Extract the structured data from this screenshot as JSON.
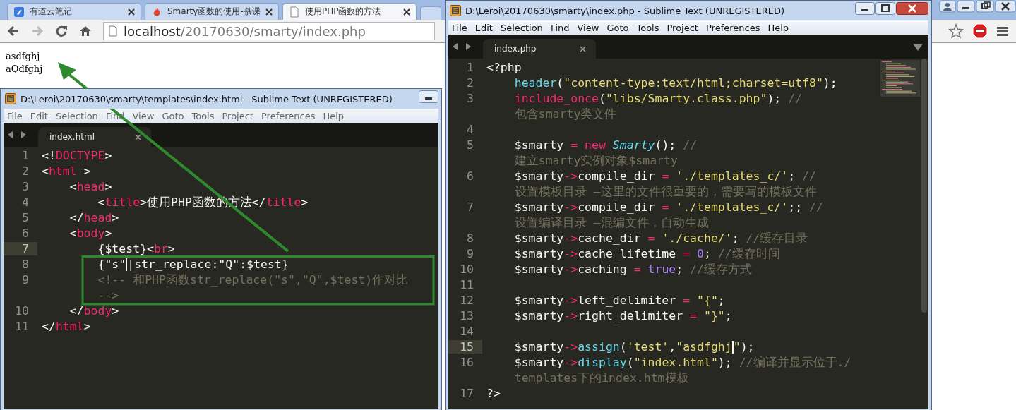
{
  "browser": {
    "tabs": [
      {
        "title": "有道云笔记",
        "selected": false
      },
      {
        "title": "Smarty函数的使用-慕课",
        "selected": false
      },
      {
        "title": "使用PHP函数的方法",
        "selected": true
      }
    ],
    "buttons": [
      {
        "kind": "back",
        "disabled": false
      },
      {
        "kind": "forward",
        "disabled": true
      },
      {
        "kind": "reload",
        "disabled": false
      },
      {
        "kind": "home",
        "disabled": false
      }
    ],
    "address": {
      "host": "localhost",
      "path": "/20170630/smarty/index.php"
    },
    "page_lines": [
      "asdfghj",
      "aQdfghj"
    ]
  },
  "editors": [
    {
      "title": "D:\\Leroi\\20170630\\smarty\\templates\\index.html - Sublime Text (UNREGISTERED)",
      "menu": [
        "File",
        "Edit",
        "Selection",
        "Find",
        "View",
        "Goto",
        "Tools",
        "Project",
        "Preferences",
        "Help"
      ],
      "tab": "index.html",
      "lines": [
        {
          "number": "1",
          "current": false,
          "rows": [
            [
              {
                "kind": "plain",
                "text": "<!"
              },
              {
                "kind": "tag",
                "text": "DOCTYPE"
              },
              {
                "kind": "plain",
                "text": ">"
              }
            ]
          ]
        },
        {
          "number": "2",
          "current": false,
          "rows": [
            [
              {
                "kind": "plain",
                "text": "<"
              },
              {
                "kind": "tag",
                "text": "html"
              },
              {
                "kind": "plain",
                "text": " >"
              }
            ]
          ]
        },
        {
          "number": "3",
          "current": false,
          "rows": [
            [
              {
                "kind": "plain",
                "text": "    <"
              },
              {
                "kind": "tag",
                "text": "head"
              },
              {
                "kind": "plain",
                "text": ">"
              }
            ]
          ]
        },
        {
          "number": "4",
          "current": false,
          "rows": [
            [
              {
                "kind": "plain",
                "text": "        <"
              },
              {
                "kind": "tag",
                "text": "title"
              },
              {
                "kind": "plain",
                "text": ">使用PHP函数的方法</"
              },
              {
                "kind": "tag",
                "text": "title"
              },
              {
                "kind": "plain",
                "text": ">"
              }
            ]
          ]
        },
        {
          "number": "5",
          "current": false,
          "rows": [
            [
              {
                "kind": "plain",
                "text": "    </"
              },
              {
                "kind": "tag",
                "text": "head"
              },
              {
                "kind": "plain",
                "text": ">"
              }
            ]
          ]
        },
        {
          "number": "6",
          "current": false,
          "rows": [
            [
              {
                "kind": "plain",
                "text": "    <"
              },
              {
                "kind": "tag",
                "text": "body"
              },
              {
                "kind": "plain",
                "text": ">"
              }
            ]
          ]
        },
        {
          "number": "7",
          "current": true,
          "rows": [
            [
              {
                "kind": "plain",
                "text": "        {$test}<"
              },
              {
                "kind": "tag",
                "text": "br"
              },
              {
                "kind": "plain",
                "text": ">"
              }
            ]
          ]
        },
        {
          "number": "8",
          "current": false,
          "rows": [
            [
              {
                "kind": "plain",
                "text": "        {\"s\"",
                "cursor": true
              },
              {
                "kind": "plain",
                "text": "|str_replace:\"Q\":$test}"
              }
            ]
          ]
        },
        {
          "number": "9",
          "current": false,
          "rows": [
            [
              {
                "kind": "comment",
                "text": "        <!-- 和PHP函数str_replace(\"s\",\"Q\",$test)作对比"
              }
            ],
            [
              {
                "kind": "comment",
                "text": "        -->"
              }
            ]
          ]
        },
        {
          "number": "10",
          "current": false,
          "rows": [
            [
              {
                "kind": "plain",
                "text": "    </"
              },
              {
                "kind": "tag",
                "text": "body"
              },
              {
                "kind": "plain",
                "text": ">"
              }
            ]
          ]
        },
        {
          "number": "11",
          "current": false,
          "rows": [
            [
              {
                "kind": "plain",
                "text": "</"
              },
              {
                "kind": "tag",
                "text": "html"
              },
              {
                "kind": "plain",
                "text": ">"
              }
            ]
          ]
        }
      ]
    },
    {
      "title": "D:\\Leroi\\20170630\\smarty\\index.php - Sublime Text (UNREGISTERED)",
      "menu": [
        "File",
        "Edit",
        "Selection",
        "Find",
        "View",
        "Goto",
        "Tools",
        "Project",
        "Preferences",
        "Help"
      ],
      "tab": "index.php",
      "lines": [
        {
          "number": "1",
          "current": false,
          "rows": [
            [
              {
                "kind": "plain",
                "text": "<?php"
              }
            ]
          ]
        },
        {
          "number": "2",
          "current": false,
          "rows": [
            [
              {
                "kind": "plain",
                "text": "    "
              },
              {
                "kind": "func",
                "text": "header"
              },
              {
                "kind": "plain",
                "text": "("
              },
              {
                "kind": "string",
                "text": "\"content-type:text/html;charset=utf8\""
              },
              {
                "kind": "plain",
                "text": ");"
              }
            ]
          ]
        },
        {
          "number": "3",
          "current": false,
          "rows": [
            [
              {
                "kind": "plain",
                "text": "    "
              },
              {
                "kind": "keyword",
                "text": "include_once"
              },
              {
                "kind": "plain",
                "text": "("
              },
              {
                "kind": "string",
                "text": "\"libs/Smarty.class.php\""
              },
              {
                "kind": "plain",
                "text": ");"
              },
              {
                "kind": "comment",
                "text": " //"
              }
            ],
            [
              {
                "kind": "comment",
                "text": "    包含smarty类文件"
              }
            ]
          ]
        },
        {
          "number": "4",
          "current": false
        },
        {
          "number": "5",
          "current": false,
          "rows": [
            [
              {
                "kind": "plain",
                "text": "    $smarty "
              },
              {
                "kind": "keyword",
                "text": "="
              },
              {
                "kind": "plain",
                "text": " "
              },
              {
                "kind": "keyword",
                "text": "new"
              },
              {
                "kind": "plain",
                "text": " "
              },
              {
                "kind": "class",
                "text": "Smarty"
              },
              {
                "kind": "plain",
                "text": "();"
              },
              {
                "kind": "comment",
                "text": " //"
              }
            ],
            [
              {
                "kind": "comment",
                "text": "    建立smarty实例对象$smarty"
              }
            ]
          ]
        },
        {
          "number": "6",
          "current": false,
          "rows": [
            [
              {
                "kind": "plain",
                "text": "    $smarty"
              },
              {
                "kind": "keyword",
                "text": "->"
              },
              {
                "kind": "plain",
                "text": "compile_dir "
              },
              {
                "kind": "keyword",
                "text": "="
              },
              {
                "kind": "plain",
                "text": " "
              },
              {
                "kind": "string",
                "text": "'./templates_c/'"
              },
              {
                "kind": "plain",
                "text": ";"
              },
              {
                "kind": "comment",
                "text": " //"
              }
            ],
            [
              {
                "kind": "comment",
                "text": "    设置模板目录 —这里的文件很重要的，需要写的模板文件"
              }
            ]
          ]
        },
        {
          "number": "7",
          "current": false,
          "rows": [
            [
              {
                "kind": "plain",
                "text": "    $smarty"
              },
              {
                "kind": "keyword",
                "text": "->"
              },
              {
                "kind": "plain",
                "text": "compile_dir "
              },
              {
                "kind": "keyword",
                "text": "="
              },
              {
                "kind": "plain",
                "text": " "
              },
              {
                "kind": "string",
                "text": "'./templates_c/'"
              },
              {
                "kind": "plain",
                "text": ";;"
              },
              {
                "kind": "comment",
                "text": " //"
              }
            ],
            [
              {
                "kind": "comment",
                "text": "    设置编译目录 —混编文件，自动生成"
              }
            ]
          ]
        },
        {
          "number": "8",
          "current": false,
          "rows": [
            [
              {
                "kind": "plain",
                "text": "    $smarty"
              },
              {
                "kind": "keyword",
                "text": "->"
              },
              {
                "kind": "plain",
                "text": "cache_dir "
              },
              {
                "kind": "keyword",
                "text": "="
              },
              {
                "kind": "plain",
                "text": " "
              },
              {
                "kind": "string",
                "text": "'./cache/'"
              },
              {
                "kind": "plain",
                "text": ";"
              },
              {
                "kind": "comment",
                "text": " //缓存目录"
              }
            ]
          ]
        },
        {
          "number": "9",
          "current": false,
          "rows": [
            [
              {
                "kind": "plain",
                "text": "    $smarty"
              },
              {
                "kind": "keyword",
                "text": "->"
              },
              {
                "kind": "plain",
                "text": "cache_lifetime "
              },
              {
                "kind": "keyword",
                "text": "="
              },
              {
                "kind": "plain",
                "text": " "
              },
              {
                "kind": "number",
                "text": "0"
              },
              {
                "kind": "plain",
                "text": ";"
              },
              {
                "kind": "comment",
                "text": " //缓存时间"
              }
            ]
          ]
        },
        {
          "number": "10",
          "current": false,
          "rows": [
            [
              {
                "kind": "plain",
                "text": "    $smarty"
              },
              {
                "kind": "keyword",
                "text": "->"
              },
              {
                "kind": "plain",
                "text": "caching "
              },
              {
                "kind": "keyword",
                "text": "="
              },
              {
                "kind": "plain",
                "text": " "
              },
              {
                "kind": "number",
                "text": "true"
              },
              {
                "kind": "plain",
                "text": ";"
              },
              {
                "kind": "comment",
                "text": " //缓存方式"
              }
            ]
          ]
        },
        {
          "number": "11",
          "current": false
        },
        {
          "number": "12",
          "current": false,
          "rows": [
            [
              {
                "kind": "plain",
                "text": "    $smarty"
              },
              {
                "kind": "keyword",
                "text": "->"
              },
              {
                "kind": "plain",
                "text": "left_delimiter "
              },
              {
                "kind": "keyword",
                "text": "="
              },
              {
                "kind": "plain",
                "text": " "
              },
              {
                "kind": "string",
                "text": "\"{\""
              },
              {
                "kind": "plain",
                "text": ";"
              }
            ]
          ]
        },
        {
          "number": "13",
          "current": false,
          "rows": [
            [
              {
                "kind": "plain",
                "text": "    $smarty"
              },
              {
                "kind": "keyword",
                "text": "->"
              },
              {
                "kind": "plain",
                "text": "right_delimiter "
              },
              {
                "kind": "keyword",
                "text": "="
              },
              {
                "kind": "plain",
                "text": " "
              },
              {
                "kind": "string",
                "text": "\"}\""
              },
              {
                "kind": "plain",
                "text": ";"
              }
            ]
          ]
        },
        {
          "number": "14",
          "current": false
        },
        {
          "number": "15",
          "current": true,
          "rows": [
            [
              {
                "kind": "plain",
                "text": "    $smarty"
              },
              {
                "kind": "keyword",
                "text": "->"
              },
              {
                "kind": "func",
                "text": "assign"
              },
              {
                "kind": "plain",
                "text": "("
              },
              {
                "kind": "string",
                "text": "'test'"
              },
              {
                "kind": "plain",
                "text": ","
              },
              {
                "kind": "string",
                "text": "\"asdfghj",
                "cursor": true
              },
              {
                "kind": "string",
                "text": "\""
              },
              {
                "kind": "plain",
                "text": ");"
              }
            ]
          ]
        },
        {
          "number": "16",
          "current": false,
          "rows": [
            [
              {
                "kind": "plain",
                "text": "    $smarty"
              },
              {
                "kind": "keyword",
                "text": "->"
              },
              {
                "kind": "func",
                "text": "display"
              },
              {
                "kind": "plain",
                "text": "("
              },
              {
                "kind": "string",
                "text": "\"index.html\""
              },
              {
                "kind": "plain",
                "text": ");"
              },
              {
                "kind": "comment",
                "text": " //编译并显示位于./"
              }
            ],
            [
              {
                "kind": "comment",
                "text": "    templates下的index.htm模板"
              }
            ]
          ]
        },
        {
          "number": "17",
          "current": false,
          "rows": [
            [
              {
                "kind": "plain",
                "text": "?>"
              }
            ]
          ]
        }
      ]
    }
  ]
}
